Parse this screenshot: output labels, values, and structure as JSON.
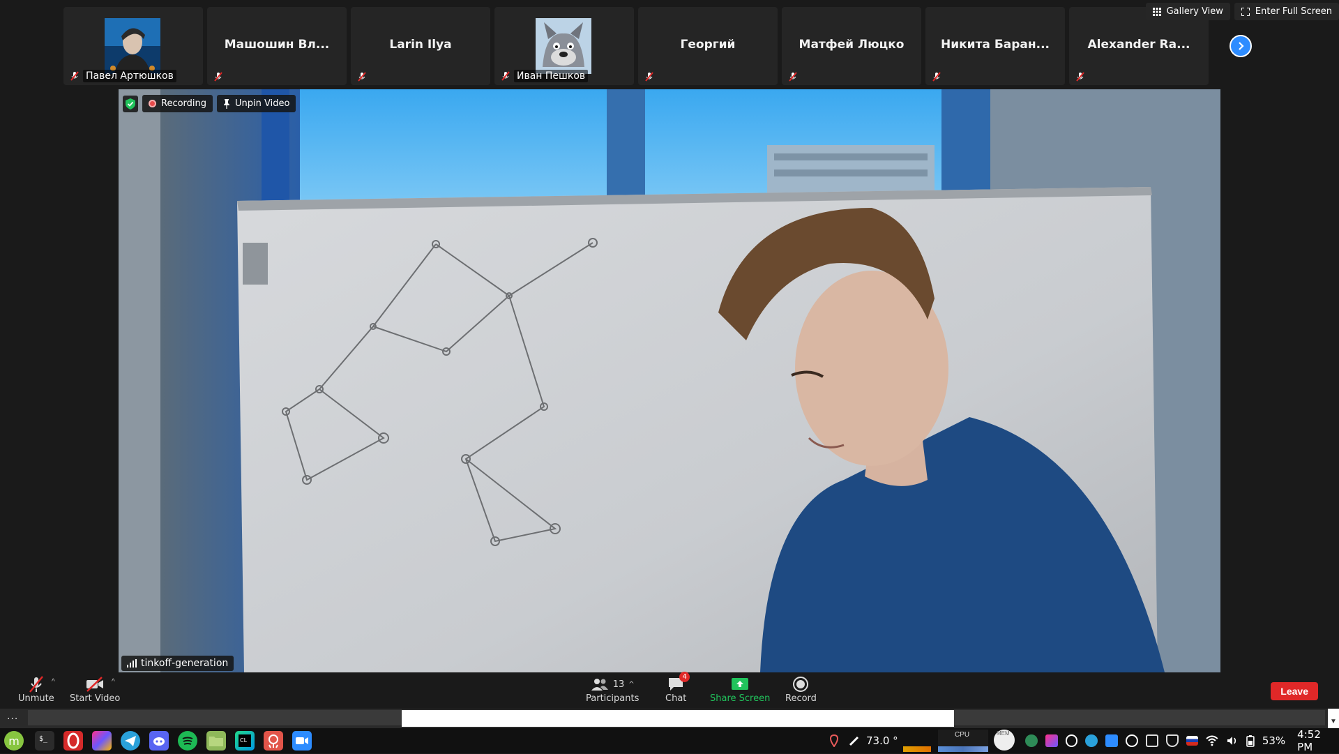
{
  "top_bar": {
    "gallery_view_label": "Gallery View",
    "full_screen_label": "Enter Full Screen"
  },
  "participants": [
    {
      "name": "Павел Артюшков",
      "has_avatar": true,
      "avatar": "man-portrait",
      "muted": true
    },
    {
      "name": "Машошин Вл...",
      "has_avatar": false,
      "muted": true
    },
    {
      "name": "Larin Ilya",
      "has_avatar": false,
      "muted": true
    },
    {
      "name": "Иван Пешков",
      "has_avatar": true,
      "avatar": "wolf-cartoon",
      "muted": true
    },
    {
      "name": "Георгий",
      "has_avatar": false,
      "muted": true
    },
    {
      "name": "Матфей Люцко",
      "has_avatar": false,
      "muted": true
    },
    {
      "name": "Никита Баран...",
      "has_avatar": false,
      "muted": true
    },
    {
      "name": "Alexander Ra...",
      "has_avatar": false,
      "muted": true
    }
  ],
  "main_video": {
    "recording_label": "Recording",
    "unpin_label": "Unpin Video",
    "speaker_name": "tinkoff-generation"
  },
  "toolbar": {
    "unmute_label": "Unmute",
    "start_video_label": "Start Video",
    "participants_label": "Participants",
    "participants_count": "13",
    "chat_label": "Chat",
    "chat_badge": "4",
    "share_screen_label": "Share Screen",
    "record_label": "Record",
    "leave_label": "Leave"
  },
  "subbar": {
    "more_label": "..."
  },
  "taskbar": {
    "apps": [
      "mint-menu-icon",
      "terminal-icon",
      "opera-icon",
      "jetbrains-toolbox-icon",
      "telegram-icon",
      "discord-icon",
      "spotify-icon",
      "files-icon",
      "clion-icon",
      "gitkraken-icon",
      "zoom-icon"
    ],
    "temperature": "73.0 °",
    "cpu_label": "CPU",
    "mem_label": "MEM",
    "battery": "53%",
    "time": "4:52 PM"
  },
  "colors": {
    "zoom_blue": "#2d8cff",
    "leave_red": "#e02828",
    "share_green": "#21c35c",
    "background": "#1a1a1a"
  }
}
